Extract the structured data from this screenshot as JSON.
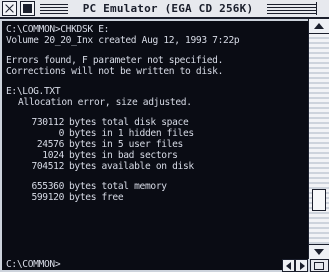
{
  "window": {
    "title": "PC Emulator (EGA CD 256K)"
  },
  "terminal": {
    "lines": {
      "cmd": "C:\\COMMON>CHKDSK E:",
      "volume": "Volume 20_20_Inx created Aug 12, 1993 7:22p",
      "err1": "Errors found, F parameter not specified.",
      "err2": "Corrections will not be written to disk.",
      "file": "E:\\LOG.TXT",
      "alloc": "Allocation error, size adjusted."
    },
    "disk_stats": [
      {
        "value": "730112",
        "text": "bytes total disk space"
      },
      {
        "value": "0",
        "text": "bytes in 1 hidden files"
      },
      {
        "value": "24576",
        "text": "bytes in 5 user files"
      },
      {
        "value": "1024",
        "text": "bytes in bad sectors"
      },
      {
        "value": "704512",
        "text": "bytes available on disk"
      }
    ],
    "mem_stats": [
      {
        "value": "655360",
        "text": "bytes total memory"
      },
      {
        "value": "599120",
        "text": "bytes free"
      }
    ],
    "prompt": "C:\\COMMON>"
  },
  "colors": {
    "terminal_bg": "#0a0c14",
    "terminal_fg": "#d7dbe6",
    "chrome": "#cdd3dc"
  }
}
